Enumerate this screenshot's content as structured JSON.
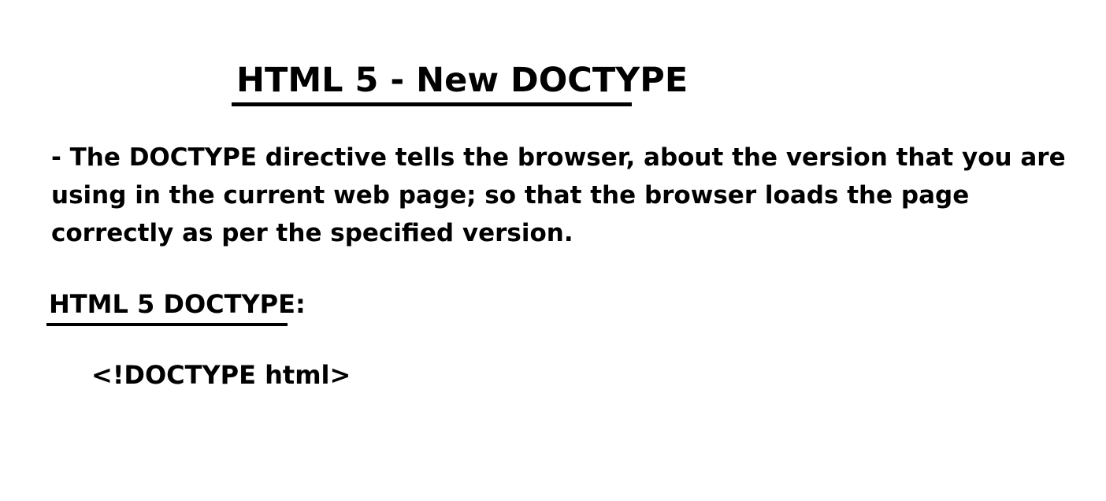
{
  "slide": {
    "title": "HTML 5 - New DOCTYPE",
    "paragraph_lines": [
      "- The DOCTYPE directive tells the browser, about the version that you are",
      "using in the current web page; so that the browser loads the page",
      "correctly as per the specified version."
    ],
    "subheading": "HTML 5 DOCTYPE:",
    "code": "<!DOCTYPE html>"
  }
}
